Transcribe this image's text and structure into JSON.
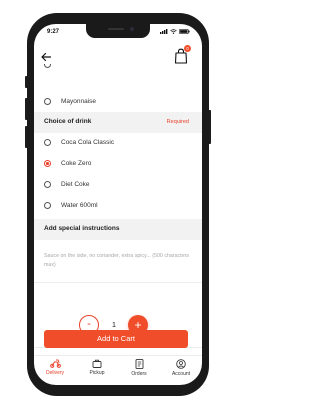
{
  "status": {
    "time": "9:27"
  },
  "header": {
    "back_icon": "arrow-left-icon",
    "cart_icon": "shopping-bag-icon",
    "cart_badge": "0"
  },
  "addon_options": [
    {
      "label": "Mayonnaise",
      "selected": false
    }
  ],
  "drink_section": {
    "title": "Choice of drink",
    "required_label": "Required",
    "options": [
      {
        "label": "Coca Cola Classic",
        "selected": false
      },
      {
        "label": "Coke Zero",
        "selected": true
      },
      {
        "label": "Diet Coke",
        "selected": false
      },
      {
        "label": "Water 600ml",
        "selected": false
      }
    ]
  },
  "instructions": {
    "title": "Add special instructions",
    "placeholder": "Sauce on the side, no coriander, extra spicy... (500 characters max)"
  },
  "quantity": {
    "value": "1",
    "minus": "-",
    "plus": "+"
  },
  "cart_button": {
    "label": "Add to Cart"
  },
  "tabs": [
    {
      "label": "Delivery",
      "icon": "delivery-scooter-icon",
      "active": true
    },
    {
      "label": "Pickup",
      "icon": "pickup-bag-icon",
      "active": false
    },
    {
      "label": "Orders",
      "icon": "orders-receipt-icon",
      "active": false
    },
    {
      "label": "Account",
      "icon": "account-user-icon",
      "active": false
    }
  ],
  "colors": {
    "accent": "#f04e2a",
    "text": "#333333",
    "section_bg": "#f2f2f2"
  }
}
